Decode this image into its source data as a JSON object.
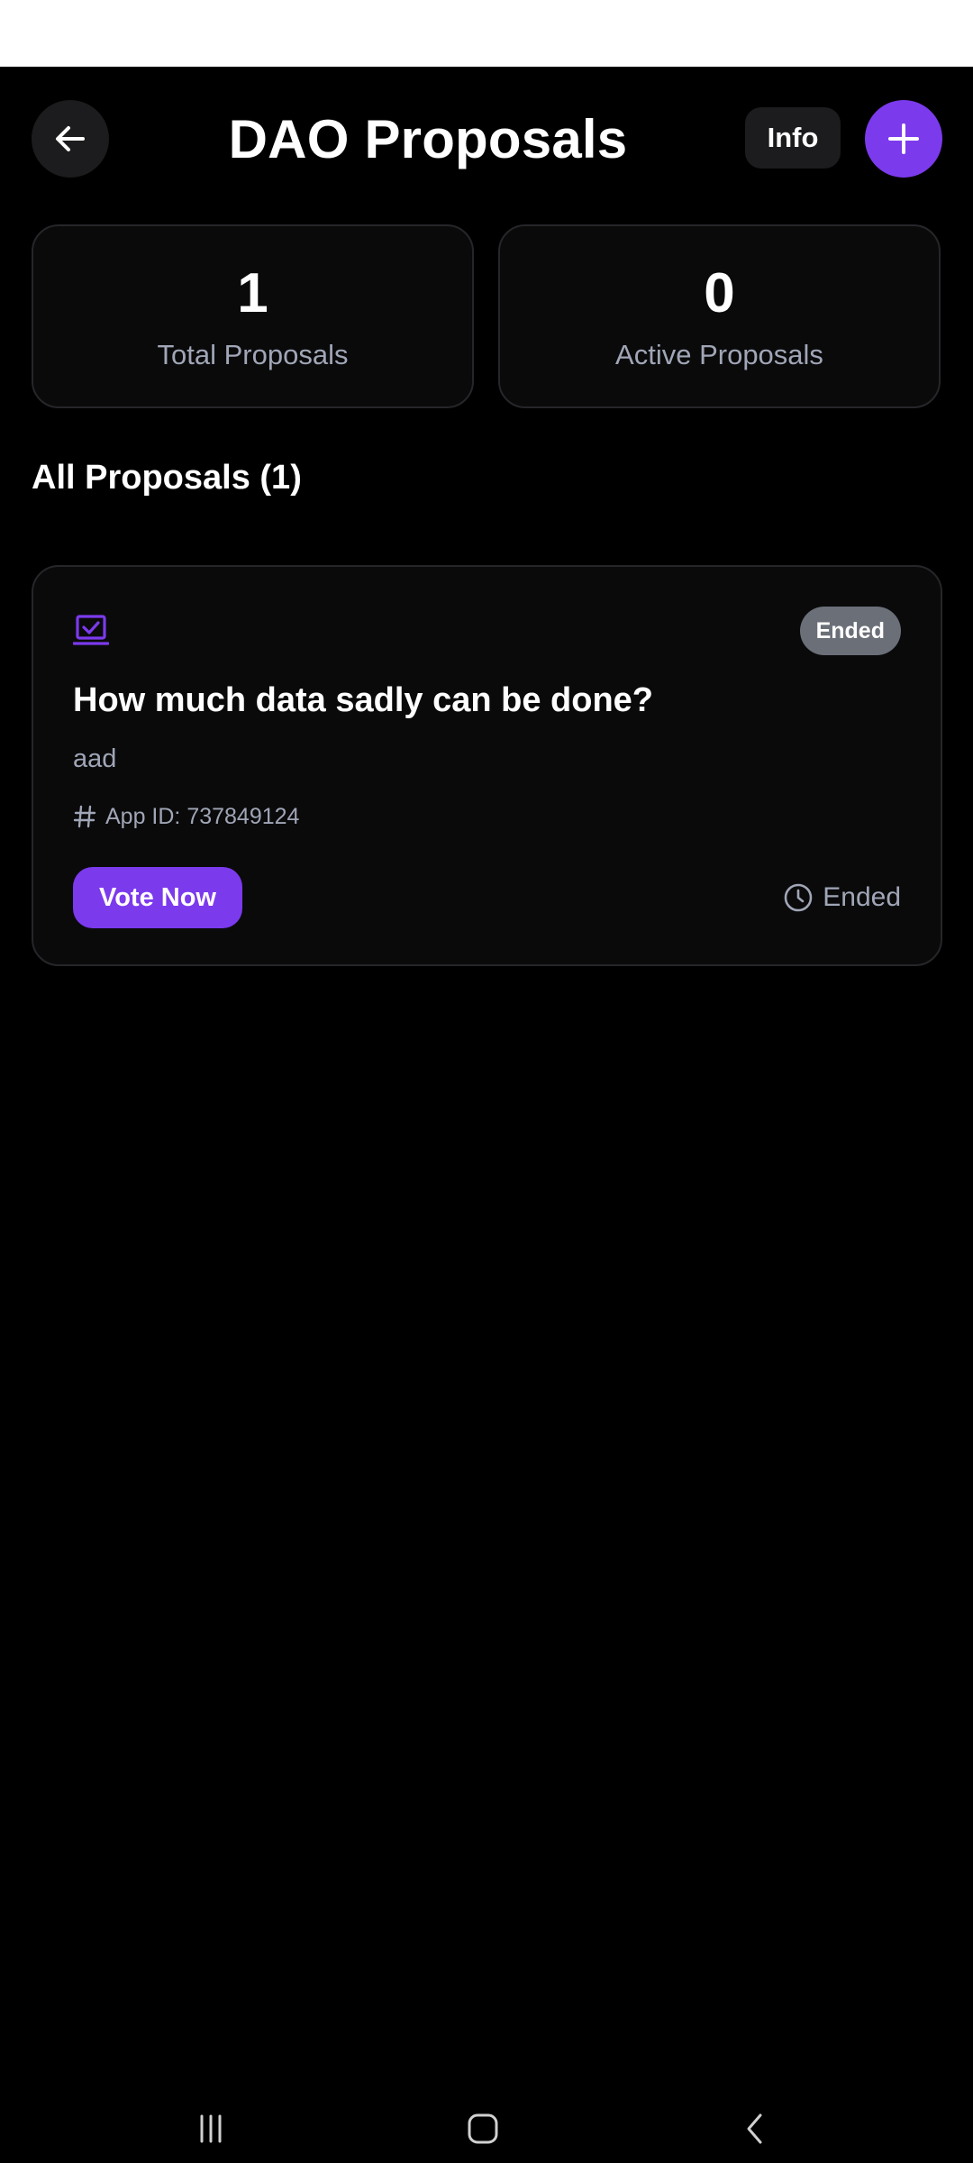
{
  "header": {
    "title": "DAO Proposals",
    "back_icon": "arrow-left-icon",
    "info_label": "Info",
    "add_icon": "plus-icon"
  },
  "stats": {
    "total_value": "1",
    "total_label": "Total Proposals",
    "active_value": "0",
    "active_label": "Active Proposals"
  },
  "section": {
    "title": "All Proposals (1)"
  },
  "proposals": [
    {
      "icon": "vote-box-icon",
      "status": "Ended",
      "title": "How much data sadly can be done?",
      "description": "aad",
      "app_id": "App ID: 737849124",
      "vote_label": "Vote Now",
      "time_status": "Ended"
    }
  ],
  "colors": {
    "accent": "#7c3aed",
    "background": "#000000",
    "card": "#0a0a0b",
    "muted_text": "#a0a6b6",
    "badge": "#6b6f78"
  },
  "nav": {
    "recents_icon": "recents-icon",
    "home_icon": "home-icon",
    "back_icon": "nav-back-icon"
  }
}
